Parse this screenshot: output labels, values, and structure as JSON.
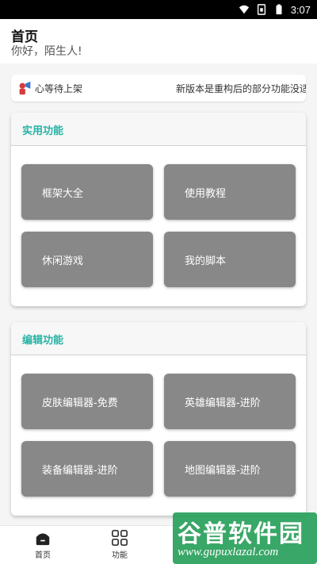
{
  "status_bar": {
    "time": "3:07",
    "icons": [
      "wifi-icon",
      "sim-icon",
      "battery-icon"
    ]
  },
  "header": {
    "title": "首页",
    "subtitle": "你好，陌生人!"
  },
  "notice": {
    "icon": "speaker-icon",
    "ticker_left": "心等待上架",
    "ticker_right": "新版本是重构后的部分功能没适配!"
  },
  "sections": {
    "practical": {
      "title": "实用功能",
      "items": [
        "框架大全",
        "使用教程",
        "休闲游戏",
        "我的脚本"
      ]
    },
    "editing": {
      "title": "编辑功能",
      "items": [
        "皮肤编辑器-免费",
        "英雄编辑器-进阶",
        "装备编辑器-进阶",
        "地图编辑器-进阶"
      ]
    }
  },
  "bottom_nav": [
    {
      "label": "首页",
      "icon": "home-icon",
      "active": true
    },
    {
      "label": "功能",
      "icon": "grid-icon",
      "active": false
    }
  ],
  "watermark": {
    "title": "谷普软件园",
    "url": "www.gupuxlazal.com"
  },
  "colors": {
    "accent": "#27b3a6",
    "tile": "#888888",
    "statusbar": "#000000"
  }
}
